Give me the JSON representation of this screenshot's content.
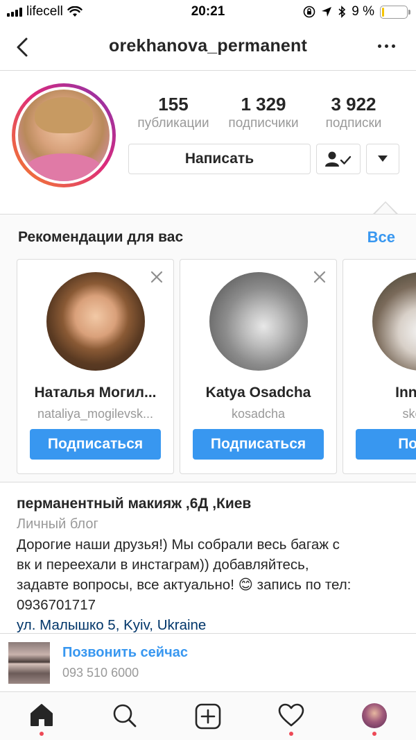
{
  "status_bar": {
    "carrier": "lifecell",
    "time": "20:21",
    "battery_percent": "9 %",
    "battery_level": 0.09,
    "battery_color": "#f5c400"
  },
  "header": {
    "username": "orekhanova_permanent",
    "back_icon": "chevron-left-icon",
    "more_icon": "more-horizontal-icon"
  },
  "profile": {
    "stats": [
      {
        "value": "155",
        "label": "публикации"
      },
      {
        "value": "1 329",
        "label": "подписчики"
      },
      {
        "value": "3 922",
        "label": "подписки"
      }
    ],
    "message_button": "Написать",
    "following_icon": "person-check-icon",
    "dropdown_icon": "triangle-down-icon"
  },
  "recommendations": {
    "title": "Рекомендации для вас",
    "see_all": "Все",
    "cards": [
      {
        "name": "Наталья Могил...",
        "handle": "nataliya_mogilevsk...",
        "follow": "Подписаться"
      },
      {
        "name": "Katya Osadcha",
        "handle": "kosadcha",
        "follow": "Подписаться"
      },
      {
        "name": "Inna Sk",
        "handle": "skorop",
        "follow": "Подпи"
      }
    ]
  },
  "bio": {
    "name": "перманентный макияж ,6Д ,Киев",
    "category": "Личный блог",
    "text_lines": [
      "Дорогие наши друзья!) Мы собрали весь багаж с",
      "вк и переехали в инстаграм)) добавляйтесь,",
      "задавте вопросы, все актуально! 😊 запись по тел:",
      "0936701717"
    ],
    "address": "ул. Малышко 5, Kyiv, Ukraine"
  },
  "call": {
    "label": "Позвонить сейчас",
    "number": "093 510 6000"
  },
  "tab_bar": {
    "items": [
      "home-icon",
      "search-icon",
      "add-post-icon",
      "heart-icon",
      "profile-avatar"
    ],
    "accent": "#ed4956"
  },
  "colors": {
    "link_blue": "#3897f0",
    "border": "#dbdbdb",
    "muted_text": "#999999"
  }
}
